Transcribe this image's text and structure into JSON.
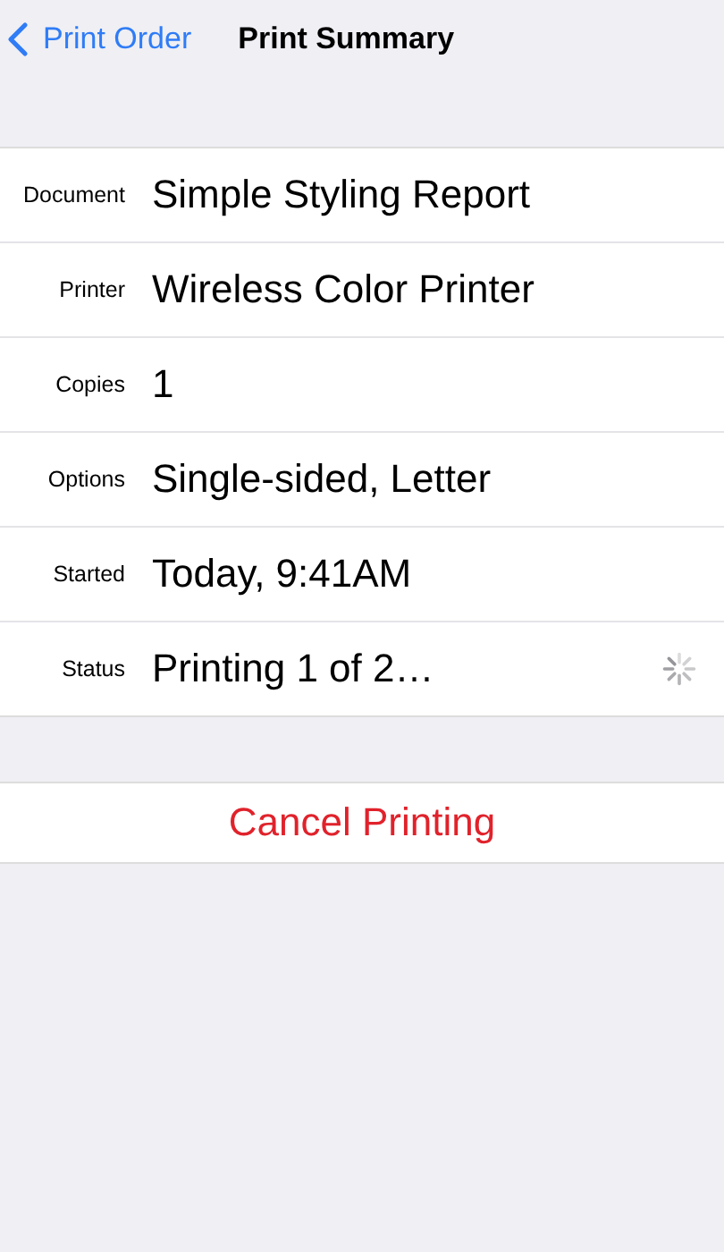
{
  "nav": {
    "back": "Print Order",
    "title": "Print Summary"
  },
  "rows": [
    {
      "label": "Document",
      "value": "Simple Styling Report",
      "busy": false
    },
    {
      "label": "Printer",
      "value": "Wireless Color Printer",
      "busy": false
    },
    {
      "label": "Copies",
      "value": "1",
      "busy": false
    },
    {
      "label": "Options",
      "value": "Single-sided, Letter",
      "busy": false
    },
    {
      "label": "Started",
      "value": "Today, 9:41AM",
      "busy": false
    },
    {
      "label": "Status",
      "value": "Printing 1 of 2…",
      "busy": true
    }
  ],
  "cancel": "Cancel Printing"
}
